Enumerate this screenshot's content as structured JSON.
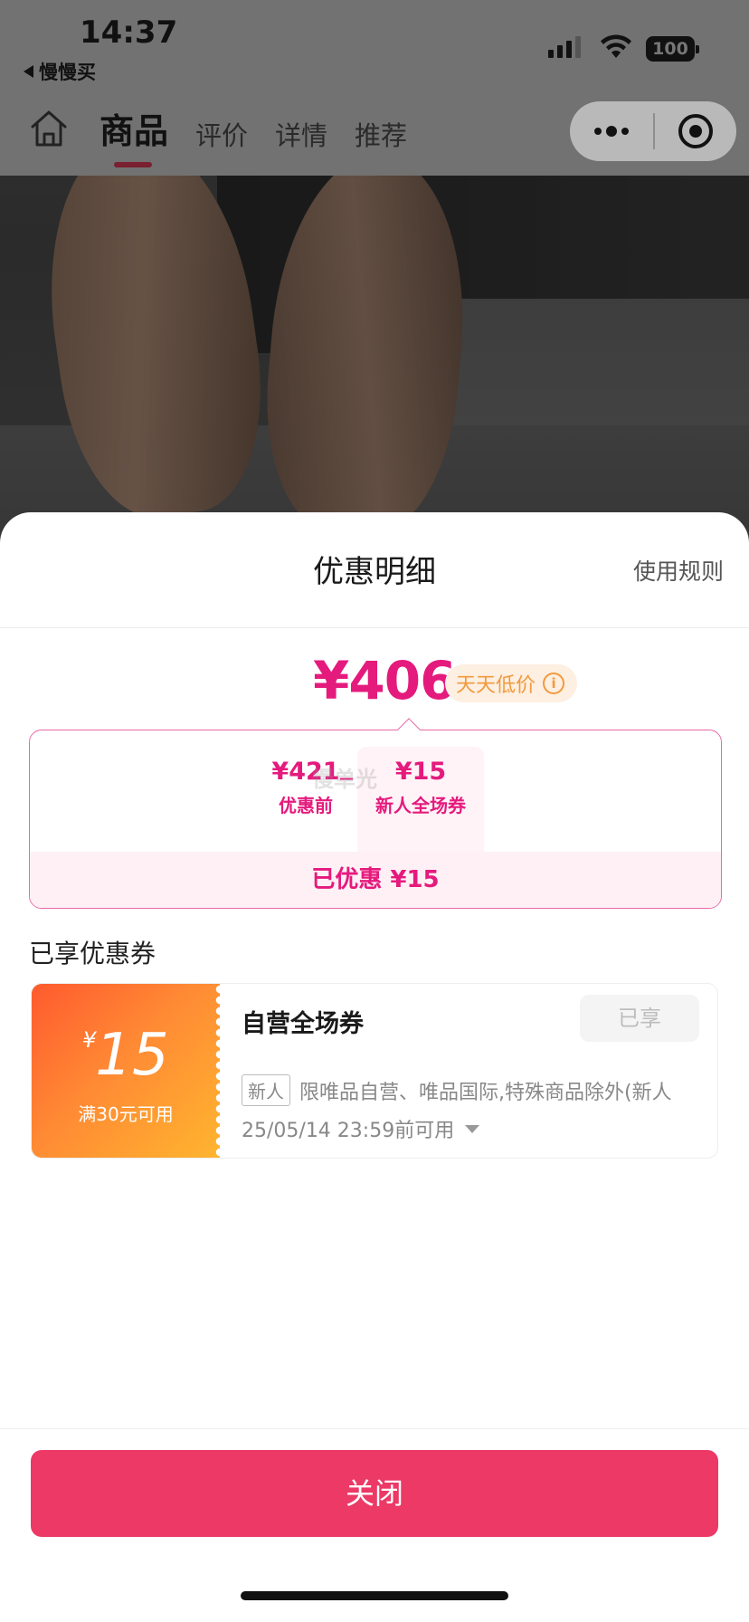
{
  "status_bar": {
    "time": "14:37",
    "back_app": "慢慢买",
    "battery": "100"
  },
  "nav": {
    "home_icon": "home-icon",
    "tabs": [
      {
        "label": "商品",
        "active": true
      },
      {
        "label": "评价",
        "active": false
      },
      {
        "label": "详情",
        "active": false
      },
      {
        "label": "推荐",
        "active": false
      }
    ],
    "capsule": {
      "more_icon": "more-dots-icon",
      "close_icon": "target-icon"
    }
  },
  "sheet": {
    "title": "优惠明细",
    "rules_link": "使用规则",
    "final_price": "¥406",
    "price_tag": "天天低价",
    "price_tag_icon": "info-icon",
    "calc": {
      "before_amount": "¥421",
      "before_label": "优惠前",
      "minus": "_",
      "coupon_amount": "¥15",
      "coupon_label": "新人全场券",
      "watermark": "慢单光",
      "total_saved": "已优惠 ¥15"
    },
    "section_title": "已享优惠券",
    "coupon": {
      "currency": "¥",
      "value": "15",
      "condition": "满30元可用",
      "name": "自营全场券",
      "status_button": "已享",
      "badge": "新人",
      "scope": "限唯品自营、唯品国际,特殊商品除外(新人",
      "expire": "25/05/14 23:59前可用"
    },
    "close_button": "关闭"
  },
  "colors": {
    "accent_pink": "#e51a7d",
    "close_button": "#ec3966",
    "coupon_orange": "#ff8a34",
    "tag_bg": "#fdefe1"
  }
}
